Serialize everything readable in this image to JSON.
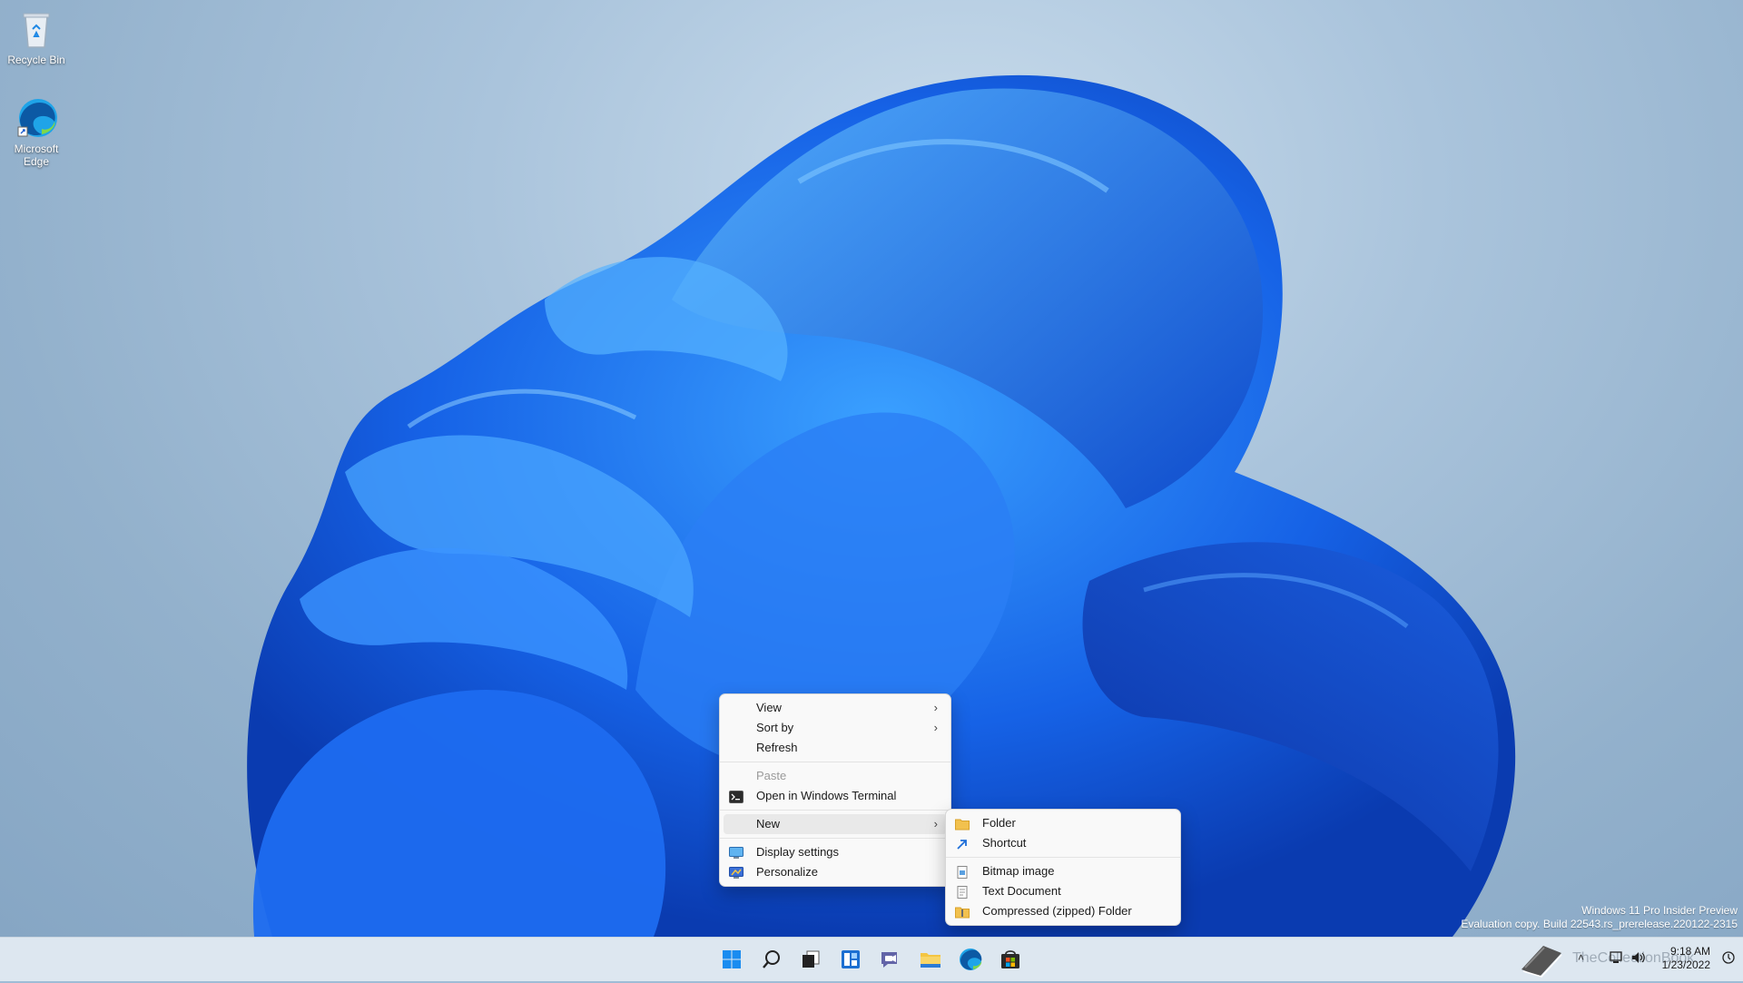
{
  "desktop": {
    "icons": [
      {
        "label": "Recycle Bin"
      },
      {
        "label": "Microsoft\nEdge"
      }
    ],
    "watermark": {
      "line1": "Windows 11 Pro Insider Preview",
      "line2": "Evaluation copy. Build 22543.rs_prerelease.220122-2315"
    },
    "site_watermark": "TheCollectionBook"
  },
  "context_menu": {
    "items": [
      {
        "label": "View",
        "has_submenu": true
      },
      {
        "label": "Sort by",
        "has_submenu": true
      },
      {
        "label": "Refresh"
      },
      {
        "label": "Paste",
        "disabled": true
      },
      {
        "label": "Open in Windows Terminal",
        "icon": "terminal-icon"
      },
      {
        "label": "New",
        "has_submenu": true,
        "active": true
      },
      {
        "label": "Display settings",
        "icon": "display-icon"
      },
      {
        "label": "Personalize",
        "icon": "personalize-icon"
      }
    ]
  },
  "new_submenu": {
    "items": [
      {
        "label": "Folder",
        "icon": "folder-icon"
      },
      {
        "label": "Shortcut",
        "icon": "shortcut-icon"
      },
      {
        "label": "Bitmap image",
        "icon": "bitmap-icon"
      },
      {
        "label": "Text Document",
        "icon": "text-document-icon"
      },
      {
        "label": "Compressed (zipped) Folder",
        "icon": "zip-folder-icon"
      }
    ]
  },
  "taskbar": {
    "apps": [
      "start-icon",
      "search-icon",
      "task-view-icon",
      "widgets-icon",
      "chat-icon",
      "file-explorer-icon",
      "edge-icon",
      "store-icon"
    ],
    "clock": {
      "time": "9:18 AM",
      "date": "1/23/2022"
    }
  },
  "colors": {
    "accent": "#0067c0",
    "bloom_dark": "#0a3fb8",
    "bloom_light": "#2f8cff"
  }
}
